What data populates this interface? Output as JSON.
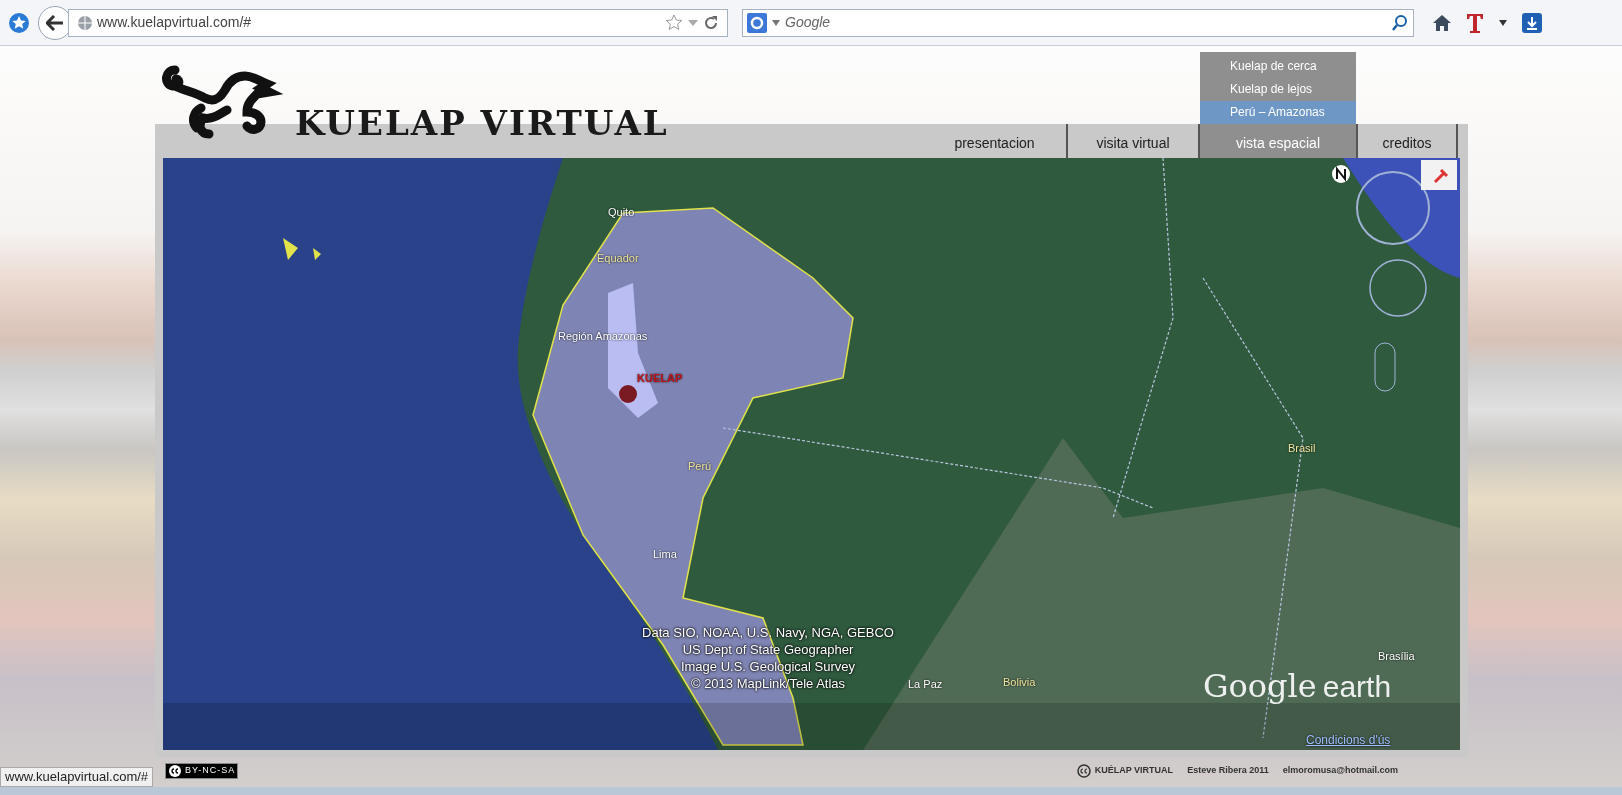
{
  "browser": {
    "url": "www.kuelapvirtual.com/#",
    "search_placeholder": "Google"
  },
  "site": {
    "title": "KUELAP VIRTUAL"
  },
  "nav": [
    {
      "label": "presentacion",
      "expanded": false
    },
    {
      "label": "visita virtual",
      "expanded": false
    },
    {
      "label": "vista espacial",
      "expanded": true,
      "menu": [
        {
          "label": "Kuelap de cerca",
          "selected": false
        },
        {
          "label": "Kuelap de lejos",
          "selected": false
        },
        {
          "label": "Perú – Amazonas",
          "selected": true
        }
      ]
    },
    {
      "label": "creditos",
      "expanded": false
    }
  ],
  "map": {
    "labels": [
      "Quito",
      "Equador",
      "Región Amazonas",
      "KUELAP",
      "Perú",
      "Lima",
      "Brasil",
      "La Paz",
      "Bolivia",
      "Brasília"
    ],
    "attribution": [
      "Data SIO, NOAA, U.S. Navy, NGA, GEBCO",
      "US Dept of State Geographer",
      "Image U.S. Geological Survey",
      "© 2013 MapLink/Tele Atlas"
    ],
    "logo": [
      "Google",
      "earth"
    ],
    "terms": "Condicions d'ús"
  },
  "footer": {
    "license": "BY-NC-SA",
    "site": "KUÉLAP VIRTUAL",
    "author": "Esteve Ribera 2011",
    "email": "elmoromusa@hotmail.com"
  },
  "status_bar": {
    "link": "www.kuelapvirtual.com/#"
  }
}
